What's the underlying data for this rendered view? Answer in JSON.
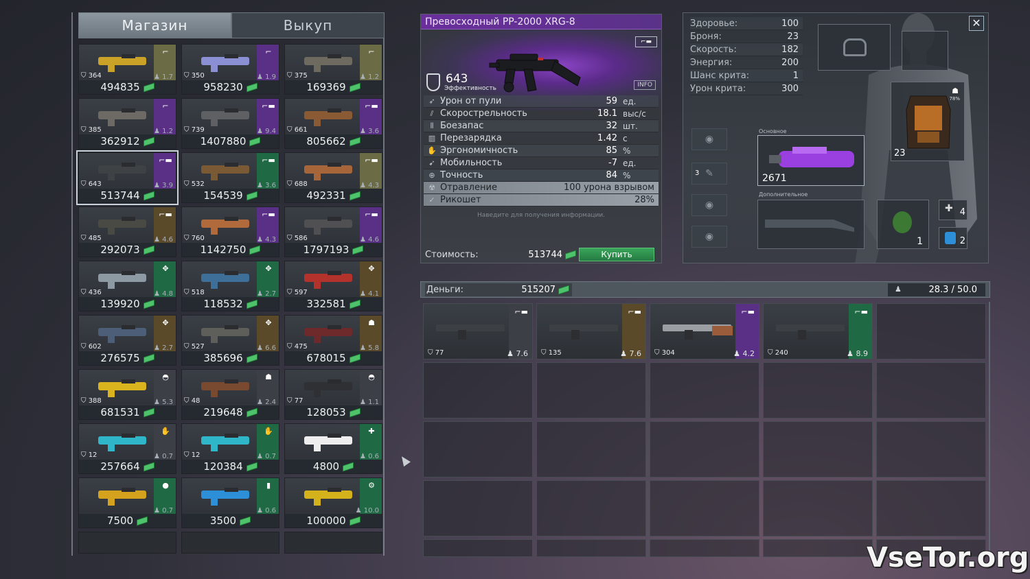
{
  "shop": {
    "tabs": [
      {
        "label": "Магазин",
        "active": true
      },
      {
        "label": "Выкуп",
        "active": false
      }
    ],
    "items": [
      {
        "eff": "364",
        "wt": "1.7",
        "price": "494835",
        "rarity": "#6b6b46",
        "icon": "pistol-icon",
        "art": "#c9a227"
      },
      {
        "eff": "350",
        "wt": "1.9",
        "price": "958230",
        "rarity": "#5a2f86",
        "icon": "pistol-icon",
        "art": "#8b8fd4"
      },
      {
        "eff": "375",
        "wt": "1.2",
        "price": "169369",
        "rarity": "#6b6b46",
        "icon": "pistol-icon",
        "art": "#6f6a60"
      },
      {
        "eff": "385",
        "wt": "1.2",
        "price": "362912",
        "rarity": "#5a2f86",
        "icon": "pistol-icon",
        "art": "#6d6a66"
      },
      {
        "eff": "739",
        "wt": "9.4",
        "price": "1407880",
        "rarity": "#5a2f86",
        "icon": "rifle-icon",
        "art": "#5f6063"
      },
      {
        "eff": "661",
        "wt": "3.6",
        "price": "805662",
        "rarity": "#5a2f86",
        "icon": "rifle-icon",
        "art": "#8a5a34"
      },
      {
        "eff": "643",
        "wt": "3.9",
        "price": "513744",
        "rarity": "#5a2f86",
        "icon": "rifle-icon",
        "art": "#3f4245",
        "selected": true
      },
      {
        "eff": "532",
        "wt": "3.6",
        "price": "154539",
        "rarity": "#1f6a44",
        "icon": "rifle-icon",
        "art": "#7a5a34"
      },
      {
        "eff": "688",
        "wt": "4.3",
        "price": "492331",
        "rarity": "#6b6b46",
        "icon": "rifle-icon",
        "art": "#a7663a"
      },
      {
        "eff": "485",
        "wt": "4.6",
        "price": "292073",
        "rarity": "#5a4a2a",
        "icon": "rifle-icon",
        "art": "#4a4a44"
      },
      {
        "eff": "760",
        "wt": "4.3",
        "price": "1142750",
        "rarity": "#5a2f86",
        "icon": "rifle-icon",
        "art": "#b06a3c"
      },
      {
        "eff": "586",
        "wt": "4.6",
        "price": "1797193",
        "rarity": "#5a2f86",
        "icon": "rifle-icon",
        "art": "#505052"
      },
      {
        "eff": "436",
        "wt": "4.8",
        "price": "139920",
        "rarity": "#1f6a44",
        "icon": "launcher-icon",
        "art": "#8d9aa4"
      },
      {
        "eff": "518",
        "wt": "2.7",
        "price": "118532",
        "rarity": "#1f6a44",
        "icon": "launcher-icon",
        "art": "#3d6f99"
      },
      {
        "eff": "597",
        "wt": "4.1",
        "price": "332581",
        "rarity": "#5a4a2a",
        "icon": "launcher-icon",
        "art": "#b3322c"
      },
      {
        "eff": "602",
        "wt": "2.7",
        "price": "276575",
        "rarity": "#5a4a2a",
        "icon": "launcher-icon",
        "art": "#4d5f78"
      },
      {
        "eff": "527",
        "wt": "6.6",
        "price": "385696",
        "rarity": "#5a4a2a",
        "icon": "launcher-icon",
        "art": "#5e5e5a"
      },
      {
        "eff": "475",
        "wt": "5.8",
        "price": "678015",
        "rarity": "#5a4a2a",
        "icon": "armor-icon",
        "art": "#6e2a2a"
      },
      {
        "eff": "388",
        "wt": "5.3",
        "price": "681531",
        "rarity": "#3c4046",
        "icon": "helmet-icon",
        "art": "#d9b41f"
      },
      {
        "eff": "48",
        "wt": "2.4",
        "price": "219648",
        "rarity": "#3c4046",
        "icon": "armor-icon",
        "art": "#7a4a30"
      },
      {
        "eff": "77",
        "wt": "1.1",
        "price": "128053",
        "rarity": "#3c4046",
        "icon": "helmet-icon",
        "art": "#2e3034"
      },
      {
        "eff": "12",
        "wt": "0.7",
        "price": "257664",
        "rarity": "#3c4046",
        "icon": "glove-icon",
        "art": "#2fb6c8"
      },
      {
        "eff": "12",
        "wt": "0.7",
        "price": "120384",
        "rarity": "#1f6a44",
        "icon": "glove-icon",
        "art": "#2fb6c8"
      },
      {
        "eff": "",
        "wt": "0.6",
        "price": "4800",
        "rarity": "#1f6a44",
        "icon": "medkit-icon",
        "art": "#eeeeee"
      },
      {
        "eff": "",
        "wt": "0.7",
        "price": "7500",
        "rarity": "#1f6a44",
        "icon": "grenade-icon",
        "art": "#d4a21c"
      },
      {
        "eff": "",
        "wt": "0.6",
        "price": "3500",
        "rarity": "#1f6a44",
        "icon": "battery-icon",
        "art": "#2d8fd8"
      },
      {
        "eff": "",
        "wt": "10.0",
        "price": "100000",
        "rarity": "#1f6a44",
        "icon": "device-icon",
        "art": "#d4b21c"
      }
    ]
  },
  "detail": {
    "title": "Превосходный PP-2000 XRG-8",
    "efficiency": "643",
    "efficiency_label": "Эффективность",
    "info_label": "INFO",
    "stats": [
      {
        "label": "Урон от пули",
        "value": "59",
        "unit": "ед.",
        "icon": "bullet-icon"
      },
      {
        "label": "Скорострельность",
        "value": "18.1",
        "unit": "выс/с",
        "icon": "rate-icon"
      },
      {
        "label": "Боезапас",
        "value": "32",
        "unit": "шт.",
        "icon": "ammo-icon"
      },
      {
        "label": "Перезарядка",
        "value": "1.42",
        "unit": "с",
        "icon": "reload-icon"
      },
      {
        "label": "Эргономичность",
        "value": "85",
        "unit": "%",
        "icon": "hand-icon"
      },
      {
        "label": "Мобильность",
        "value": "-7",
        "unit": "ед.",
        "icon": "mobility-icon"
      },
      {
        "label": "Точность",
        "value": "84",
        "unit": "%",
        "icon": "crosshair-icon"
      }
    ],
    "perks": [
      {
        "label": "Отравление",
        "value": "100 урона взрывом",
        "icon": "poison-icon"
      },
      {
        "label": "Рикошет",
        "value": "28%",
        "icon": "ricochet-icon"
      }
    ],
    "hint": "Наведите для получения информации.",
    "cost_label": "Стоимость:",
    "cost_value": "513744",
    "buy_label": "Купить"
  },
  "character": {
    "stats": [
      {
        "label": "Здоровье:",
        "value": "100"
      },
      {
        "label": "Броня:",
        "value": "23"
      },
      {
        "label": "Скорость:",
        "value": "182"
      },
      {
        "label": "Энергия:",
        "value": "200"
      },
      {
        "label": "Шанс крита:",
        "value": "1"
      },
      {
        "label": "Урон крита:",
        "value": "300"
      }
    ],
    "armor_value": "23",
    "armor_durability": "78%",
    "primary_label": "Основное",
    "primary_eff": "2671",
    "secondary_label": "Дополнительное",
    "side_value": "3",
    "grenade_count": "1",
    "med_count": "4",
    "battery_count": "2"
  },
  "inventory": {
    "money_label": "Деньги:",
    "money_value": "515207",
    "weight": "28.3 / 50.0",
    "items": [
      {
        "eff": "77",
        "wt": "7.6",
        "rarity": "#3c4046"
      },
      {
        "eff": "135",
        "wt": "7.6",
        "rarity": "#5a4a2a"
      },
      {
        "eff": "304",
        "wt": "4.2",
        "rarity": "#5a2f86"
      },
      {
        "eff": "240",
        "wt": "8.9",
        "rarity": "#1f6a44"
      }
    ]
  },
  "watermark": "VseTor.org"
}
